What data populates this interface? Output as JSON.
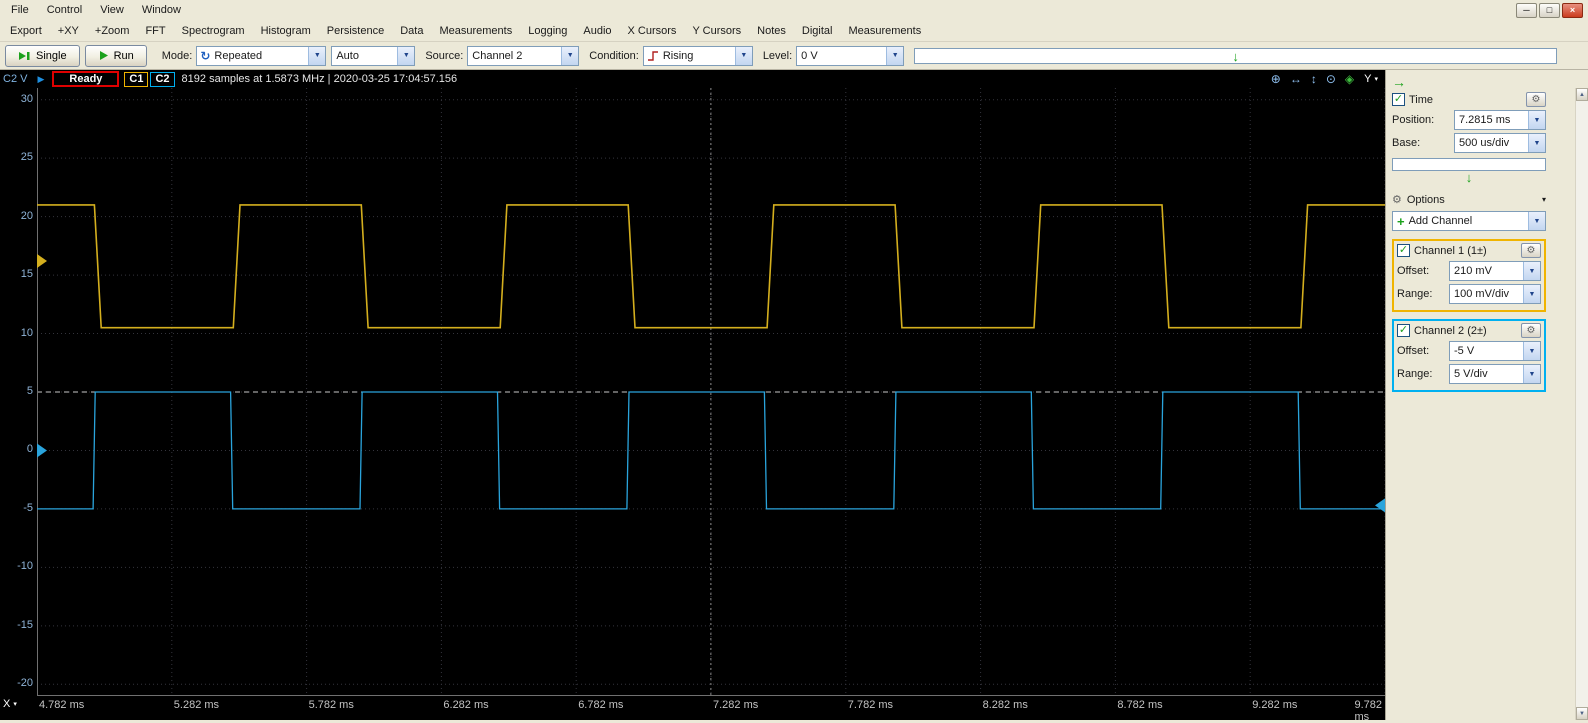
{
  "window": {
    "menus": [
      "File",
      "Control",
      "View",
      "Window"
    ]
  },
  "view_menu": [
    "Export",
    "+XY",
    "+Zoom",
    "FFT",
    "Spectrogram",
    "Histogram",
    "Persistence",
    "Data",
    "Measurements",
    "Logging",
    "Audio",
    "X Cursors",
    "Y Cursors",
    "Notes",
    "Digital",
    "Measurements"
  ],
  "toolbar": {
    "single_label": "Single",
    "run_label": "Run",
    "mode_label": "Mode:",
    "mode_value": "Repeated",
    "auto_value": "Auto",
    "source_label": "Source:",
    "source_value": "Channel 2",
    "condition_label": "Condition:",
    "condition_value": "Rising",
    "level_label": "Level:",
    "level_value": "0 V"
  },
  "status": {
    "axis_unit": "C2 V",
    "ready": "Ready",
    "c1": "C1",
    "c2": "C2",
    "info": "8192 samples at 1.5873 MHz | 2020-03-25 17:04:57.156",
    "y_button": "Y",
    "x_button": "X",
    "plot_tools": [
      {
        "name": "zoom-area-icon",
        "glyph": "⊕",
        "color": "#8fc0f0"
      },
      {
        "name": "fit-width-icon",
        "glyph": "↔",
        "color": "#8fc0f0"
      },
      {
        "name": "fit-height-icon",
        "glyph": "↕",
        "color": "#8fc0f0"
      },
      {
        "name": "magnifier-icon",
        "glyph": "⊙",
        "color": "#8fc0f0"
      },
      {
        "name": "snapshot-icon",
        "glyph": "◈",
        "color": "#3fbf3f"
      }
    ]
  },
  "sidebar": {
    "time": {
      "title": "Time",
      "position_label": "Position:",
      "position": "7.2815 ms",
      "base_label": "Base:",
      "base": "500 us/div"
    },
    "options_label": "Options",
    "add_channel_label": "Add Channel",
    "channel1": {
      "title": "Channel 1 (1±)",
      "offset_label": "Offset:",
      "offset": "210 mV",
      "range_label": "Range:",
      "range": "100 mV/div",
      "color": "#f0b400"
    },
    "channel2": {
      "title": "Channel 2 (2±)",
      "offset_label": "Offset:",
      "offset": "-5 V",
      "range_label": "Range:",
      "range": "5 V/div",
      "color": "#00b0f0"
    }
  },
  "icons": {
    "minimize": "─",
    "restore": "□",
    "close": "×",
    "check": "✓",
    "gear": "⚙",
    "combo_arrow": "▼",
    "menu_arrow": "▾",
    "down_arrow": "↓",
    "expand": "→",
    "repeat": "↻",
    "plus": "+",
    "play": "▶",
    "scroll_up": "▲",
    "scroll_down": "▼"
  },
  "chart_data": {
    "type": "line",
    "title": "Oscilloscope capture: two complementary square waves",
    "x_unit": "ms",
    "y_unit": "C2 V",
    "x_range": [
      4.782,
      9.782
    ],
    "y_range": [
      -21,
      31
    ],
    "x_ticks": [
      4.782,
      5.282,
      5.782,
      6.282,
      6.782,
      7.282,
      7.782,
      8.282,
      8.782,
      9.282,
      9.782
    ],
    "x_tick_labels": [
      "4.782 ms",
      "5.282 ms",
      "5.782 ms",
      "6.282 ms",
      "6.782 ms",
      "7.282 ms",
      "7.782 ms",
      "8.282 ms",
      "8.782 ms",
      "9.282 ms",
      "9.782 ms"
    ],
    "y_ticks": [
      30,
      25,
      20,
      15,
      10,
      5,
      0,
      -5,
      -10,
      -15,
      -20
    ],
    "grid_div": {
      "x_ms": 0.5,
      "y": 5
    },
    "trigger_time_ms": 7.2815,
    "trigger_level_line": 5,
    "series": [
      {
        "name": "Channel 1",
        "color": "#d4af1e",
        "high": 21,
        "low": 10.5,
        "period_ms": 0.99,
        "edge_ms": 0.025,
        "high_segments": [
          [
            4.782,
            4.995
          ],
          [
            5.51,
            5.985
          ],
          [
            6.5,
            6.975
          ],
          [
            7.49,
            7.965
          ],
          [
            8.48,
            8.955
          ],
          [
            9.47,
            9.782
          ]
        ],
        "marker_position": 16.2
      },
      {
        "name": "Channel 2",
        "color": "#2aa4dc",
        "high": 5,
        "low": -5,
        "period_ms": 0.99,
        "edge_ms": 0.008,
        "high_segments": [
          [
            4.99,
            5.5
          ],
          [
            5.98,
            6.49
          ],
          [
            6.97,
            7.48
          ],
          [
            7.96,
            8.47
          ],
          [
            8.95,
            9.46
          ]
        ],
        "marker_position": 0
      }
    ],
    "right_marker": {
      "name": "trigger-level-marker",
      "position": -4.7,
      "color": "#2aa4dc"
    }
  }
}
